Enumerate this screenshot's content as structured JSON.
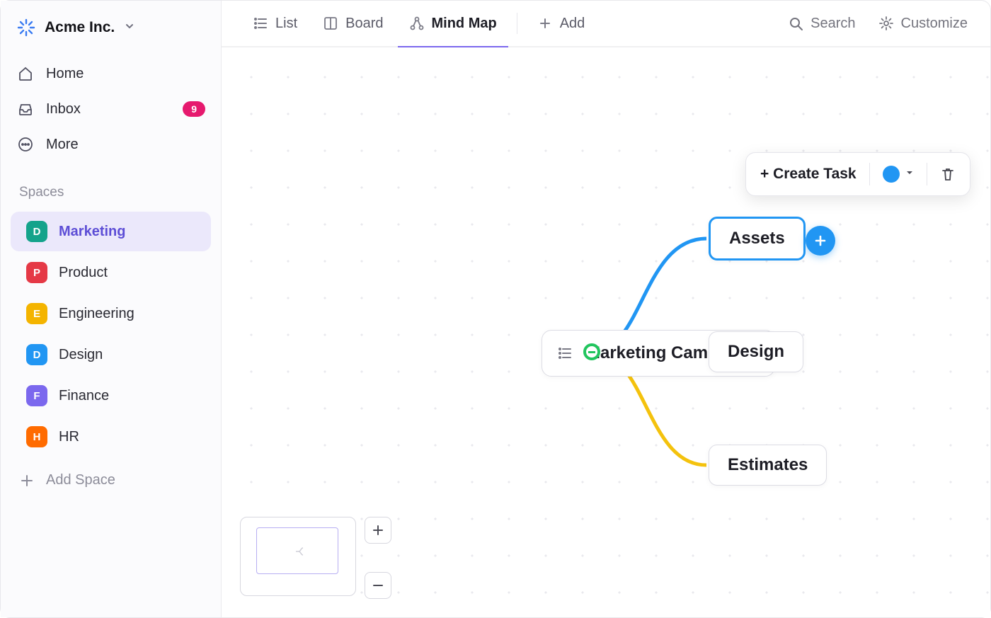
{
  "workspace": {
    "name": "Acme Inc."
  },
  "nav": {
    "home": "Home",
    "inbox": "Inbox",
    "inbox_count": "9",
    "more": "More"
  },
  "spaces_title": "Spaces",
  "spaces": [
    {
      "letter": "D",
      "label": "Marketing",
      "color": "#14a38b",
      "active": true
    },
    {
      "letter": "P",
      "label": "Product",
      "color": "#e53946",
      "active": false
    },
    {
      "letter": "E",
      "label": "Engineering",
      "color": "#f4b400",
      "active": false
    },
    {
      "letter": "D",
      "label": "Design",
      "color": "#2196f3",
      "active": false
    },
    {
      "letter": "F",
      "label": "Finance",
      "color": "#7b68ee",
      "active": false
    },
    {
      "letter": "H",
      "label": "HR",
      "color": "#ff6b00",
      "active": false
    }
  ],
  "add_space": "Add Space",
  "views": {
    "list": "List",
    "board": "Board",
    "mindmap": "Mind Map",
    "add": "Add"
  },
  "top_actions": {
    "search": "Search",
    "customize": "Customize"
  },
  "toolbar": {
    "create_task": "+ Create Task",
    "color": "#2196f3"
  },
  "mindmap": {
    "root": "Marketing Campaign",
    "children": [
      {
        "label": "Assets",
        "color": "#2196f3",
        "selected": true
      },
      {
        "label": "Design",
        "color": "#8b1fd6",
        "selected": false
      },
      {
        "label": "Estimates",
        "color": "#f4c20d",
        "selected": false
      }
    ]
  }
}
